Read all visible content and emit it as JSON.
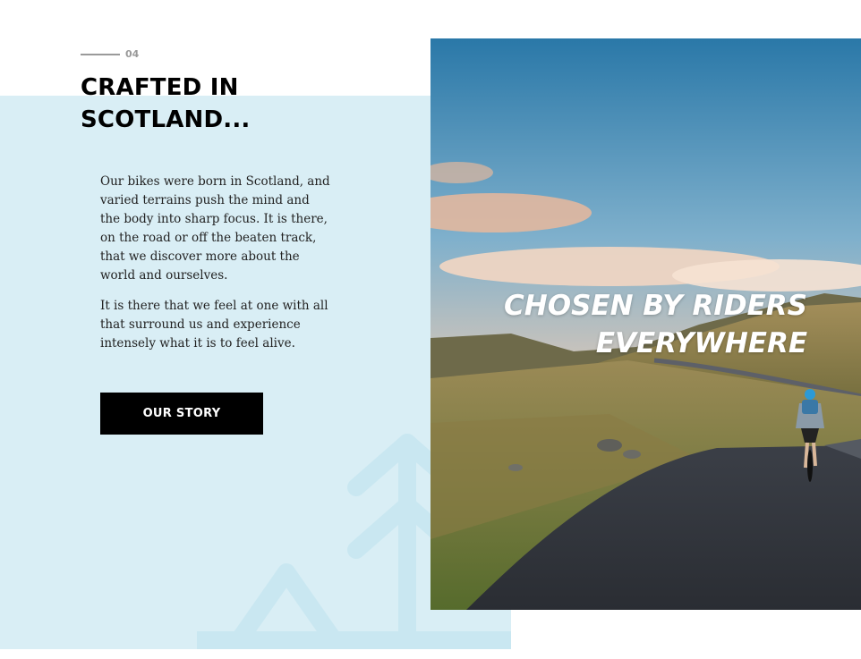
{
  "section": {
    "number": "04",
    "title": "CRAFTED IN SCOTLAND..."
  },
  "body": {
    "paragraphs": [
      "Our bikes were born in Scotland, and varied terrains push the mind and the body into sharp focus. It is there, on the road or off the beaten track, that we discover more about the world and ourselves.",
      "It is there that we feel at one with all that surround us and experience intensely what it is to feel alive."
    ]
  },
  "cta": {
    "label": "OUR STORY"
  },
  "hero": {
    "tagline_line1": "CHOSEN BY RIDERS",
    "tagline_line2": "EVERYWHERE"
  },
  "colors": {
    "panel": "#d9eef5",
    "accent_deco": "#c9e7f1",
    "button": "#000000"
  }
}
